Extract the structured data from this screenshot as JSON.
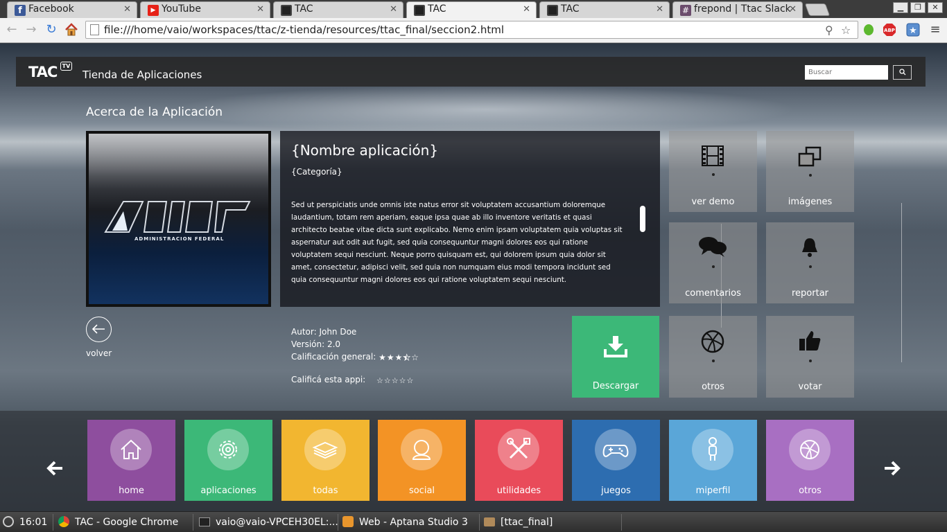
{
  "browser": {
    "tabs": [
      {
        "title": "Facebook",
        "icon": "facebook-icon",
        "color": "#3b5998",
        "active": false
      },
      {
        "title": "YouTube",
        "icon": "youtube-icon",
        "color": "#e62117",
        "active": false
      },
      {
        "title": "TAC",
        "icon": "tv-icon",
        "color": "#222222",
        "active": false
      },
      {
        "title": "TAC",
        "icon": "tv-icon",
        "color": "#222222",
        "active": true
      },
      {
        "title": "TAC",
        "icon": "tv-icon",
        "color": "#222222",
        "active": false
      },
      {
        "title": "frepond | Ttac Slack",
        "icon": "slack-icon",
        "color": "#6b4c6c",
        "active": false
      }
    ],
    "url": "file:///home/vaio/workspaces/ttac/z-tienda/resources/ttac_final/seccion2.html",
    "abp_label": "ABP"
  },
  "header": {
    "logo_text": "TAC",
    "logo_badge": "TV",
    "site_title": "Tienda de Aplicaciones",
    "search_placeholder": "Buscar"
  },
  "section_title": "Acerca de la Aplicación",
  "app": {
    "logo_caption": "ADMINISTRACION FEDERAL",
    "name": "{Nombre aplicación}",
    "category": "{Categoría}",
    "description": "Sed ut perspiciatis unde omnis iste natus error sit voluptatem accusantium doloremque laudantium, totam rem aperiam, eaque ipsa quae ab illo inventore veritatis et quasi architecto beatae vitae dicta sunt explicabo. Nemo enim ipsam voluptatem quia voluptas sit aspernatur aut odit aut fugit, sed quia consequuntur magni dolores eos qui ratione voluptatem sequi nesciunt. Neque porro quisquam est, qui dolorem ipsum quia dolor sit amet, consectetur, adipisci velit, sed quia non numquam eius modi tempora incidunt sed quia consequuntur magni dolores eos qui ratione voluptatem sequi nesciunt.",
    "author": "Autor: John Doe",
    "version": "Versión: 2.0",
    "rating_label": "Calificación general:",
    "rating": 3.5,
    "rating_max": 5,
    "rate_label": "Calificá esta appi:",
    "user_rating": 0
  },
  "back_label": "volver",
  "download_label": "Descargar",
  "actions": [
    {
      "label": "ver demo",
      "icon": "film-icon"
    },
    {
      "label": "imágenes",
      "icon": "images-icon"
    },
    {
      "label": "comentarios",
      "icon": "comments-icon"
    },
    {
      "label": "reportar",
      "icon": "bell-icon"
    },
    {
      "label": "otros",
      "icon": "basketball-icon"
    },
    {
      "label": "votar",
      "icon": "thumbs-up-icon"
    }
  ],
  "categories": [
    {
      "label": "home",
      "icon": "home-icon",
      "color": "#8e4e9e"
    },
    {
      "label": "aplicaciones",
      "icon": "gear-icon",
      "color": "#3cb878"
    },
    {
      "label": "todas",
      "icon": "layers-icon",
      "color": "#f2b630"
    },
    {
      "label": "social",
      "icon": "user-icon",
      "color": "#f39325"
    },
    {
      "label": "utilidades",
      "icon": "tools-icon",
      "color": "#e94b5a"
    },
    {
      "label": "juegos",
      "icon": "gamepad-icon",
      "color": "#2d6db0"
    },
    {
      "label": "miperfil",
      "icon": "person-icon",
      "color": "#5aa6d8"
    },
    {
      "label": "otros",
      "icon": "basketball-icon",
      "color": "#a86fc2"
    }
  ],
  "taskbar": {
    "time": "16:01",
    "items": [
      "TAC - Google Chrome",
      "vaio@vaio-VPCEH30EL:...",
      "Web - Aptana Studio 3",
      "[ttac_final]"
    ]
  }
}
